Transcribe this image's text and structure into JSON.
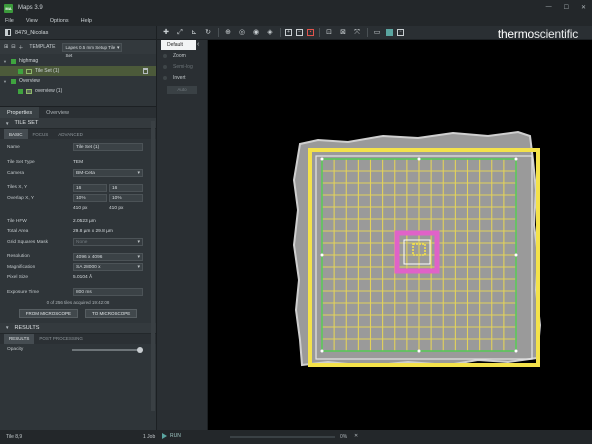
{
  "window": {
    "title": "Maps 3.9",
    "app_icon_text": "MA",
    "controls": [
      "—",
      "☐",
      "✕"
    ]
  },
  "menu": [
    "File",
    "View",
    "Options",
    "Help"
  ],
  "brand": {
    "part1": "thermo",
    "part2": "scientific"
  },
  "project": {
    "name": "8479_Nicolas"
  },
  "template_bar": {
    "label": "TEMPLATE",
    "selected": "Lapes 0.5 mm Setup Tile Set"
  },
  "layers": [
    {
      "label": "highmag",
      "level": 0
    },
    {
      "label": "Tile Set (1)",
      "level": 1,
      "selected": true
    },
    {
      "label": "Overview",
      "level": 0
    },
    {
      "label": "overview (1)",
      "level": 1
    }
  ],
  "panel_tabs": [
    "Properties",
    "Overview"
  ],
  "tile_set_section": "TILE SET",
  "tile_subtabs": [
    "BASIC",
    "FOCUS",
    "ADVANCED"
  ],
  "props": {
    "name_label": "Name",
    "name_value": "Tile Set (1)",
    "type_label": "Tile Set Type",
    "type_value": "TEM",
    "camera_label": "Camera",
    "camera_value": "BM-Ceta",
    "tiles_label": "Tiles X, Y",
    "tiles_x": "16",
    "tiles_y": "16",
    "overlap_label": "Overlap X, Y",
    "overlap_x": "10%",
    "overlap_y": "10%",
    "overlap_px_x": "410 px",
    "overlap_px_y": "410 px",
    "hfw_label": "Tile HFW",
    "hfw_value": "2.0523 µm",
    "area_label": "Total Area",
    "area_value": "29.8 µm x 29.8 µm",
    "mask_label": "Grid Squares Mask",
    "mask_value": "None",
    "resolution_label": "Resolution",
    "resolution_value": "4096 x 4096",
    "mag_label": "Magnification",
    "mag_value": "SA 28000 x",
    "pixel_label": "Pixel Size",
    "pixel_value": "5.0104 Å",
    "exposure_label": "Exposure Time",
    "exposure_value": "800 ms"
  },
  "tiles_info": "0 of 256 tiles acquired 19:42:08",
  "buttons": {
    "from_microscope": "FROM MICROSCOPE",
    "to_microscope": "TO MICROSCOPE"
  },
  "results_section": "RESULTS",
  "results_subtabs": [
    "RESULTS",
    "POST PROCESSING"
  ],
  "opacity": {
    "label": "Opacity",
    "level": 1.0
  },
  "tools": {
    "default": "Default",
    "items": [
      {
        "label": "Zoom",
        "enabled": true
      },
      {
        "label": "Semi-log",
        "enabled": false
      },
      {
        "label": "Invert",
        "enabled": true
      }
    ],
    "auto_button": "Auto"
  },
  "toolbar_icons": [
    "move-icon",
    "pan-icon",
    "ruler-icon",
    "rotate-icon",
    "map-icon",
    "target-icon",
    "stage-icon",
    "layers-icon",
    "zoom-in-icon",
    "zoom-out-icon",
    "record-icon",
    "fit-icon",
    "crop-icon",
    "expand-icon",
    "comment-icon",
    "view-icon",
    "panel-icon"
  ],
  "status": {
    "left": "Tile 8,9",
    "jobs": "1 Job",
    "run": "RUN",
    "progress_percent": "0%",
    "progress": 0.0
  },
  "grid": {
    "tiles": 16
  }
}
